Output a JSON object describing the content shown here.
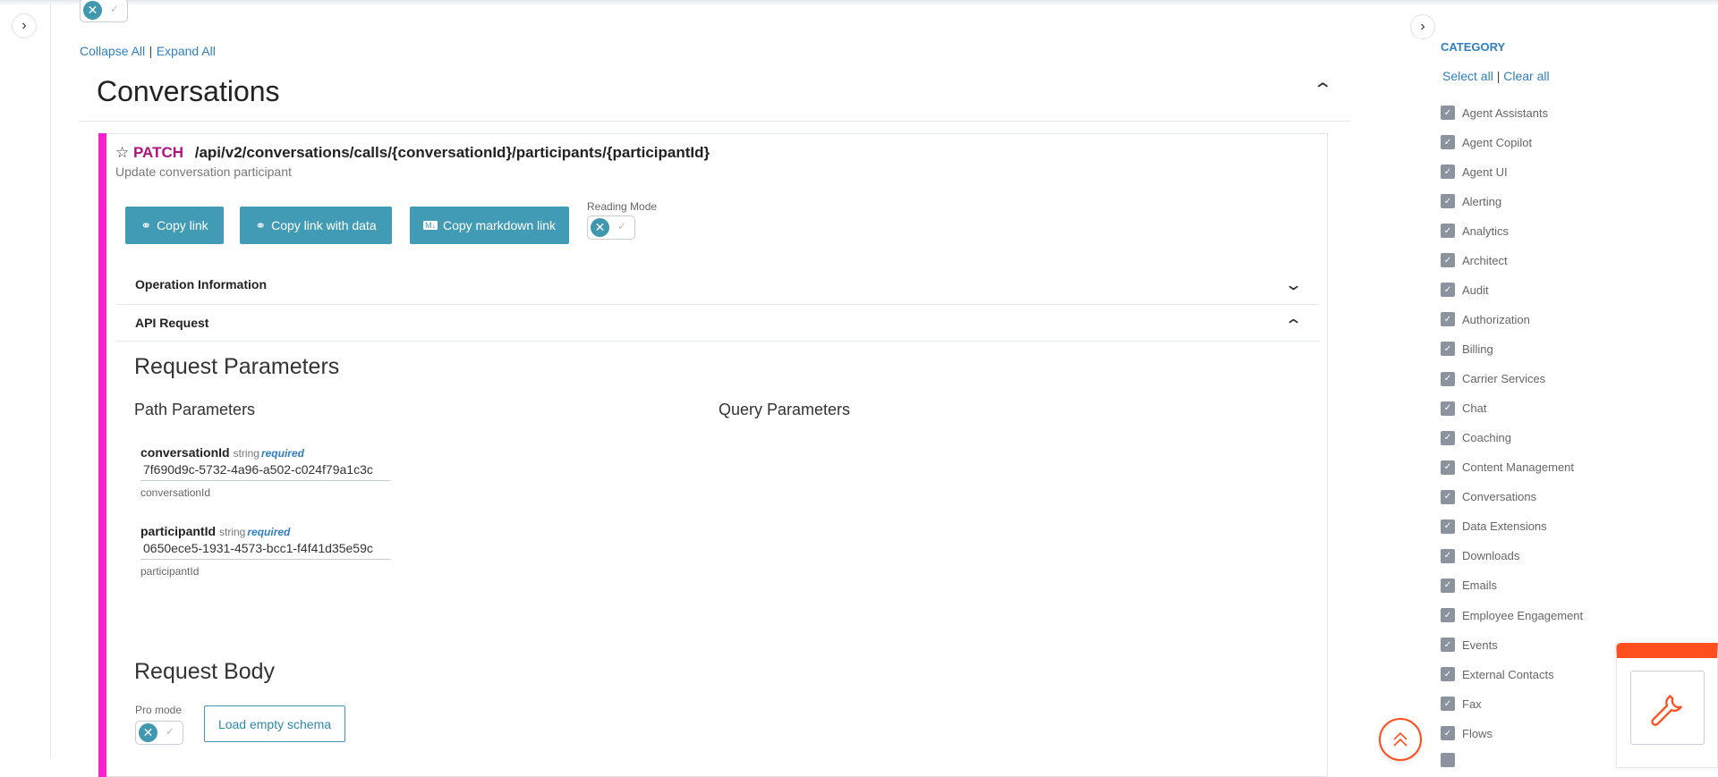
{
  "top_toggle": {
    "state": "off"
  },
  "nav": {
    "collapse_all": "Collapse All",
    "expand_all": "Expand All",
    "separator": "|"
  },
  "section": {
    "title": "Conversations"
  },
  "operation": {
    "method": "PATCH",
    "path": "/api/v2/conversations/calls/{conversationId}/participants/{participantId}",
    "summary": "Update conversation participant",
    "buttons": {
      "copy_link": "Copy link",
      "copy_link_data": "Copy link with data",
      "copy_markdown": "Copy markdown link"
    },
    "reading_mode_label": "Reading Mode",
    "operation_info": "Operation Information",
    "api_request": "API Request",
    "request_parameters": "Request Parameters",
    "path_parameters": "Path Parameters",
    "query_parameters": "Query Parameters",
    "params": [
      {
        "name": "conversationId",
        "type": "string",
        "required": "required",
        "value": "7f690d9c-5732-4a96-a502-c024f79a1c3c",
        "label": "conversationId"
      },
      {
        "name": "participantId",
        "type": "string",
        "required": "required",
        "value": "0650ece5-1931-4573-bcc1-f4f41d35e59c",
        "label": "participantId"
      }
    ],
    "request_body": "Request Body",
    "pro_mode": "Pro mode",
    "load_empty_schema": "Load empty schema"
  },
  "sidebar": {
    "heading": "CATEGORY",
    "select_all": "Select all",
    "clear_all": "Clear all",
    "separator": "|",
    "items": [
      "Agent Assistants",
      "Agent Copilot",
      "Agent UI",
      "Alerting",
      "Analytics",
      "Architect",
      "Audit",
      "Authorization",
      "Billing",
      "Carrier Services",
      "Chat",
      "Coaching",
      "Content Management",
      "Conversations",
      "Data Extensions",
      "Downloads",
      "Emails",
      "Employee Engagement",
      "Events",
      "External Contacts",
      "Fax",
      "Flows"
    ]
  },
  "colors": {
    "accent": "#429bb4",
    "link": "#2f7fc1",
    "method": "#b0137f",
    "stripe": "#ff1fce",
    "orange": "#ff4f1f"
  }
}
